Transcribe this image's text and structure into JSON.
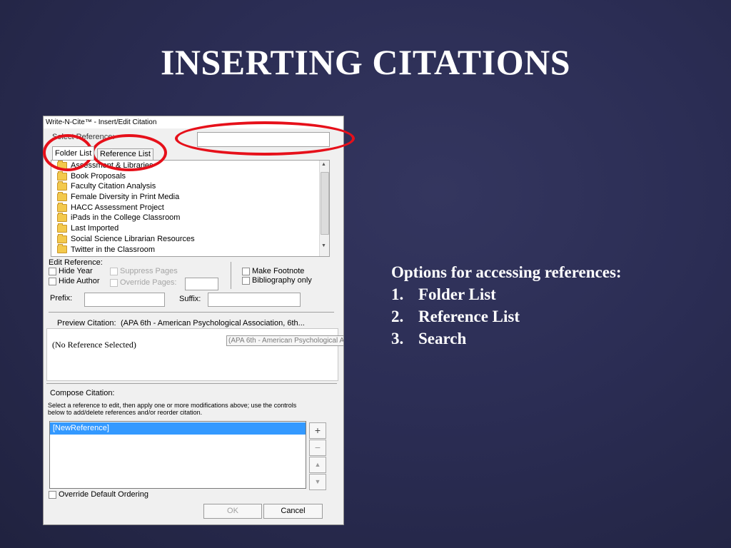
{
  "slide": {
    "title": "INSERTING CITATIONS",
    "options_heading": "Options for accessing references:",
    "options": [
      {
        "num": "1.",
        "label": "Folder List"
      },
      {
        "num": "2.",
        "label": "Reference List"
      },
      {
        "num": "3.",
        "label": "Search"
      }
    ]
  },
  "dialog": {
    "title": "Write-N-Cite™ - Insert/Edit Citation",
    "select_reference_label": "Select Reference:",
    "search_value": "",
    "tabs": [
      {
        "label": "Folder List",
        "active": true
      },
      {
        "label": "Reference List",
        "active": false
      }
    ],
    "folders": [
      "Assessment & Libraries",
      "Book Proposals",
      "Faculty Citation Analysis",
      "Female Diversity in Print Media",
      "HACC Assessment Project",
      "iPads in the College Classroom",
      "Last Imported",
      "Social Science Librarian Resources",
      "Twitter in the Classroom"
    ],
    "edit_reference": {
      "label": "Edit Reference:",
      "hide_year": "Hide Year",
      "hide_author": "Hide Author",
      "suppress_pages": "Suppress Pages",
      "override_pages": "Override Pages:",
      "make_footnote": "Make Footnote",
      "bibliography_only": "Bibliography only",
      "prefix_label": "Prefix:",
      "suffix_label": "Suffix:",
      "prefix_value": "",
      "suffix_value": ""
    },
    "preview": {
      "label": "Preview Citation:",
      "style": "(APA 6th - American Psychological Association, 6th...",
      "content": "(No Reference Selected)",
      "tooltip": "(APA 6th - American Psychological A"
    },
    "compose": {
      "label": "Compose Citation:",
      "instructions": "Select a reference to edit, then apply one or more modifications above; use the controls below to add/delete references and/or reorder citation.",
      "items": [
        "[NewReference]"
      ],
      "override_default_ordering": "Override Default Ordering"
    },
    "buttons": {
      "ok": "OK",
      "cancel": "Cancel"
    }
  }
}
